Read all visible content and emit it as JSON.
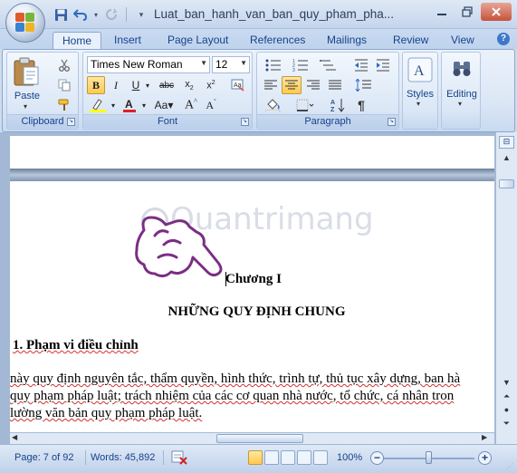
{
  "window": {
    "title": "Luat_ban_hanh_van_ban_quy_pham_pha..."
  },
  "tabs": [
    {
      "label": "Home",
      "active": true
    },
    {
      "label": "Insert"
    },
    {
      "label": "Page Layout"
    },
    {
      "label": "References"
    },
    {
      "label": "Mailings"
    },
    {
      "label": "Review"
    },
    {
      "label": "View"
    }
  ],
  "ribbon": {
    "clipboard": {
      "label": "Clipboard",
      "paste": "Paste"
    },
    "font": {
      "label": "Font",
      "font_name": "Times New Roman",
      "font_size": "12"
    },
    "paragraph": {
      "label": "Paragraph"
    },
    "styles": {
      "label": "Styles"
    },
    "editing": {
      "label": "Editing"
    }
  },
  "document": {
    "watermark": "Quantrimang",
    "chapter": "Chương I",
    "heading": "NHỮNG QUY ĐỊNH CHUNG",
    "section_title": "1. Phạm vi điều chỉnh",
    "body_lines": [
      "này quy định nguyên tắc, thẩm quyền, hình thức, trình tự, thủ tục xây dựng, ban hà",
      "quy phạm pháp luật; trách nhiệm của các cơ quan nhà nước, tổ chức, cá nhân tron",
      "lường văn bản quy phạm pháp luật."
    ]
  },
  "status": {
    "page": "Page: 7 of 92",
    "words": "Words: 45,892",
    "zoom": "100%",
    "zoom_level_percent": 100
  },
  "colors": {
    "ribbon_blue": "#15428b",
    "active_highlight": "#ffc94d",
    "pointer_hand": "#7b2e84"
  }
}
